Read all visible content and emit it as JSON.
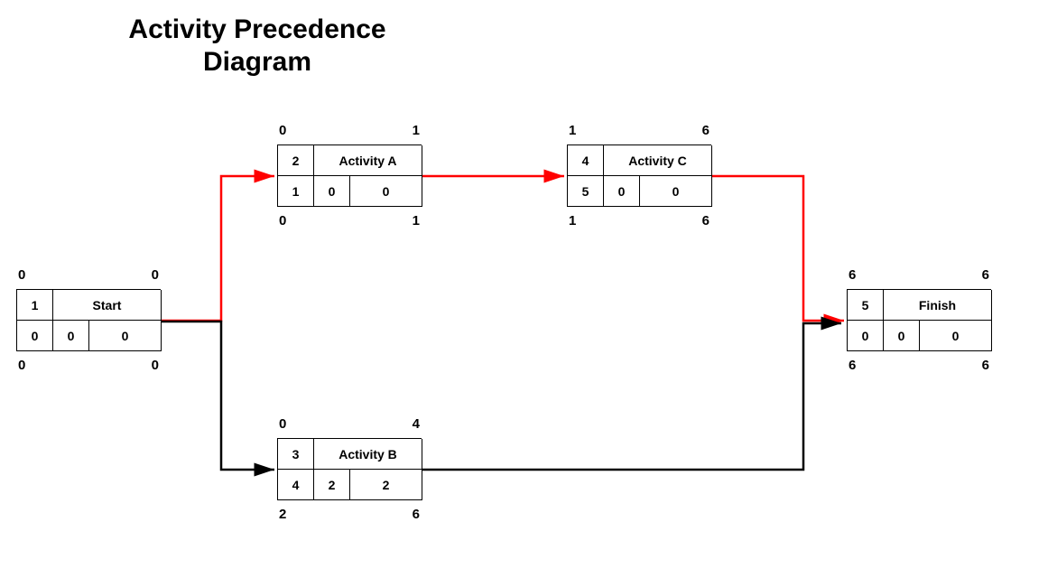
{
  "title": "Activity Precedence Diagram",
  "nodes": {
    "start": {
      "id": "1",
      "name": "Start",
      "dur": "0",
      "tf": "0",
      "ff": "0",
      "es": "0",
      "ef": "0",
      "ls": "0",
      "lf": "0"
    },
    "actA": {
      "id": "2",
      "name": "Activity A",
      "dur": "1",
      "tf": "0",
      "ff": "0",
      "es": "0",
      "ef": "1",
      "ls": "0",
      "lf": "1"
    },
    "actB": {
      "id": "3",
      "name": "Activity B",
      "dur": "4",
      "tf": "2",
      "ff": "2",
      "es": "0",
      "ef": "4",
      "ls": "2",
      "lf": "6"
    },
    "actC": {
      "id": "4",
      "name": "Activity C",
      "dur": "5",
      "tf": "0",
      "ff": "0",
      "es": "1",
      "ef": "6",
      "ls": "1",
      "lf": "6"
    },
    "finish": {
      "id": "5",
      "name": "Finish",
      "dur": "0",
      "tf": "0",
      "ff": "0",
      "es": "6",
      "ef": "6",
      "ls": "6",
      "lf": "6"
    }
  },
  "edges": [
    {
      "from": "start",
      "to": "actA",
      "critical": true
    },
    {
      "from": "start",
      "to": "actB",
      "critical": false
    },
    {
      "from": "actA",
      "to": "actC",
      "critical": true
    },
    {
      "from": "actC",
      "to": "finish",
      "critical": true
    },
    {
      "from": "actB",
      "to": "finish",
      "critical": false
    }
  ],
  "colors": {
    "critical": "#ff0000",
    "normal": "#000000"
  }
}
